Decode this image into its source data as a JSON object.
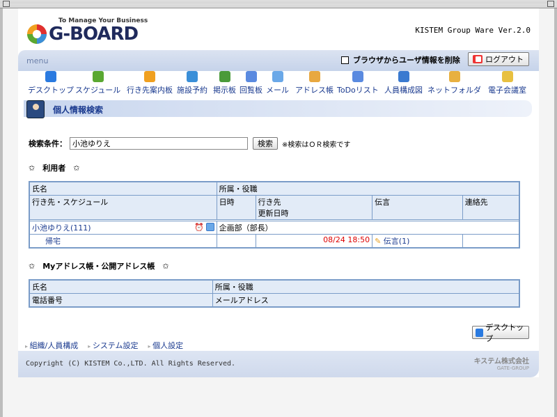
{
  "header": {
    "logo_tagline": "To Manage Your Business",
    "logo_text": "G-BOARD",
    "version": "KISTEM Group Ware Ver.2.0"
  },
  "menubar": {
    "menu_label": "menu",
    "delete_browser_info": "ブラウザからユーザ情報を削除",
    "logout_label": "ログアウト"
  },
  "nav": [
    {
      "label": "デスクトップ",
      "icon": "desktop-icon",
      "color": "#2a7ae0"
    },
    {
      "label": "スケジュール",
      "icon": "clock-icon",
      "color": "#5aa832"
    },
    {
      "label": "行き先案内板",
      "icon": "arrow-icon",
      "color": "#f0a020"
    },
    {
      "label": "施設予約",
      "icon": "building-icon",
      "color": "#3a8fd8"
    },
    {
      "label": "掲示板",
      "icon": "board-icon",
      "color": "#4a9a3a"
    },
    {
      "label": "回覧板",
      "icon": "clipboard-icon",
      "color": "#5a8ae0"
    },
    {
      "label": "メール",
      "icon": "mail-icon",
      "color": "#6aa8e8"
    },
    {
      "label": "アドレス帳",
      "icon": "book-icon",
      "color": "#e8a840"
    },
    {
      "label": "ToDoリスト",
      "icon": "todo-icon",
      "color": "#5a8ae0"
    },
    {
      "label": "人員構成図",
      "icon": "org-chart-icon",
      "color": "#3a7ad0"
    },
    {
      "label": "ネットフォルダ",
      "icon": "folder-icon",
      "color": "#e8b040"
    },
    {
      "label": "電子会議室",
      "icon": "meeting-icon",
      "color": "#e8c040"
    }
  ],
  "title": "個人情報検索",
  "search": {
    "label": "検索条件：",
    "value": "小池ゆりえ",
    "button": "検索",
    "note": "※検索はＯＲ検索です"
  },
  "users_section": {
    "heading": "✩　利用者　✩",
    "headers": {
      "name": "氏名",
      "dept": "所属・役職",
      "dest": "行き先・スケジュール",
      "datetime": "日時",
      "dest_updated": "行き先\n更新日時",
      "message": "伝言",
      "contact": "連絡先"
    },
    "rows": [
      {
        "name": "小池ゆりえ(111)",
        "dept": "企画部（部長）",
        "status": "帰宅",
        "updated": "08/24 18:50",
        "message": "伝言(1)"
      }
    ]
  },
  "address_section": {
    "heading": "✩　Myアドレス帳・公開アドレス帳　✩",
    "headers": {
      "name": "氏名",
      "dept": "所属・役職",
      "phone": "電話番号",
      "email": "メールアドレス"
    }
  },
  "footer": {
    "links": [
      "組織/人員構成",
      "システム設定",
      "個人設定"
    ],
    "desktop_button": "デスクトップ",
    "copyright": "Copyright (C) KISTEM Co.,LTD. All Rights Reserved.",
    "company": "キステム株式会社",
    "company_sub": "GATE-GROUP"
  }
}
